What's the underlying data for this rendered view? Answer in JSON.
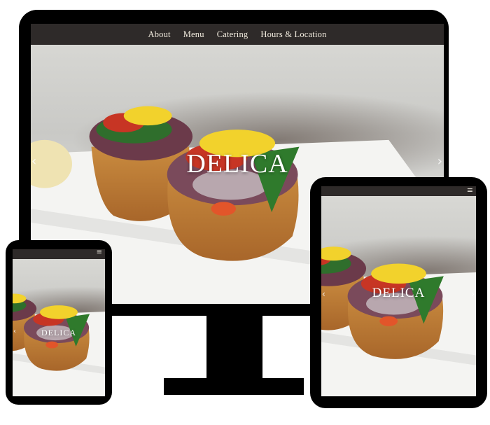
{
  "site": {
    "brand": "DELICA",
    "nav": [
      {
        "label": "About"
      },
      {
        "label": "Menu"
      },
      {
        "label": "Catering"
      },
      {
        "label": "Hours & Location"
      }
    ],
    "menu_glyph": "≡",
    "prev_arrow": "‹",
    "next_arrow": "›"
  },
  "colors": {
    "nav_bg": "#2e2a29",
    "nav_text": "#f2ecdf",
    "device_frame": "#000000"
  },
  "icons": {
    "menu": "hamburger-icon",
    "prev": "chevron-left-icon",
    "next": "chevron-right-icon"
  }
}
